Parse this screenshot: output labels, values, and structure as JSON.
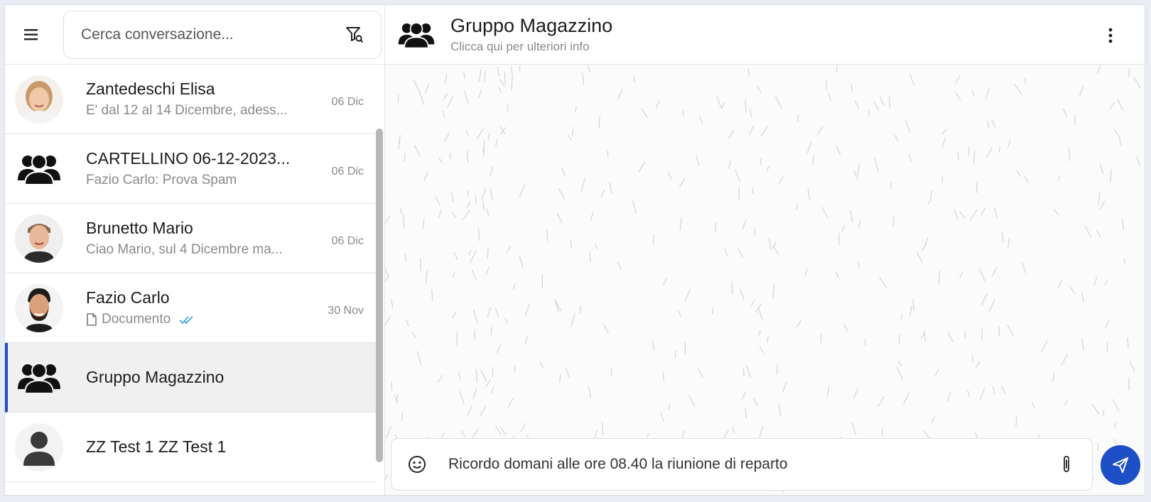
{
  "search": {
    "placeholder": "Cerca conversazione..."
  },
  "conversations": [
    {
      "name": "Zantedeschi Elisa",
      "preview": "E' dal 12 al 14 Dicembre, adess...",
      "date": "06 Dic",
      "avatar": "photo-woman"
    },
    {
      "name": "CARTELLINO 06-12-2023...",
      "preview": "Fazio Carlo: Prova Spam",
      "date": "06 Dic",
      "avatar": "group-icon"
    },
    {
      "name": "Brunetto Mario",
      "preview": "Ciao Mario, sul 4 Dicembre ma...",
      "date": "06 Dic",
      "avatar": "photo-man"
    },
    {
      "name": "Fazio Carlo",
      "preview": "Documento",
      "date": "30 Nov",
      "avatar": "photo-man-beard"
    },
    {
      "name": "Gruppo Magazzino",
      "preview": "",
      "date": "",
      "avatar": "group-icon",
      "active": true
    },
    {
      "name": "ZZ Test 1 ZZ Test 1",
      "preview": "",
      "date": "",
      "avatar": "user-icon"
    }
  ],
  "chat": {
    "title": "Gruppo Magazzino",
    "subtitle": "Clicca qui per ulteriori info"
  },
  "composer": {
    "value": "Ricordo domani alle ore 08.40 la riunione di reparto"
  },
  "colors": {
    "accent": "#1e4fc7",
    "read_ticks": "#2e9be0"
  },
  "icons": [
    "hamburger-menu-icon",
    "filter-search-icon",
    "group-icon",
    "user-icon",
    "document-icon",
    "double-check-icon",
    "kebab-menu-icon",
    "emoji-icon",
    "paperclip-icon",
    "send-icon"
  ]
}
